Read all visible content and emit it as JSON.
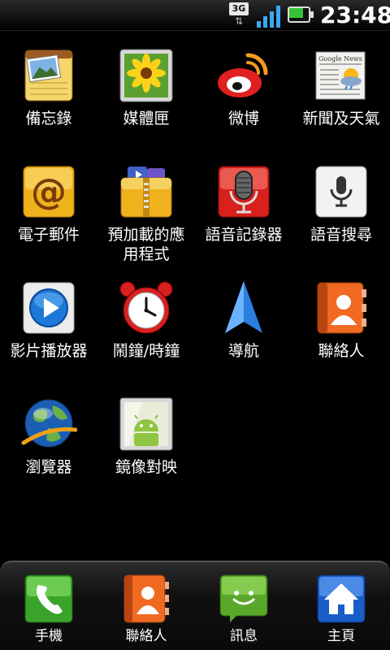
{
  "status_bar": {
    "network_type": "3G",
    "network_arrows": "⇅",
    "signal_icon": "signal-bars-icon",
    "battery_icon": "battery-icon",
    "battery_level": 0.7,
    "time": "23:48",
    "colors": {
      "signal": "#3aa8f0",
      "battery": "#35c335"
    }
  },
  "apps": [
    {
      "id": "notes",
      "label": "備忘錄",
      "icon": "notepad-icon"
    },
    {
      "id": "media",
      "label": "媒體匣",
      "icon": "gallery-icon"
    },
    {
      "id": "weibo",
      "label": "微博",
      "icon": "weibo-icon"
    },
    {
      "id": "news",
      "label": "新聞及天氣",
      "icon": "news-weather-icon",
      "icon_text": "Google News"
    },
    {
      "id": "email",
      "label": "電子郵件",
      "icon": "email-icon",
      "icon_text": "@"
    },
    {
      "id": "preloaded",
      "label_line1": "預加載的應",
      "label_line2": "用程式",
      "icon": "folder-icon"
    },
    {
      "id": "recorder",
      "label": "語音記錄器",
      "icon": "microphone-icon"
    },
    {
      "id": "voicesearch",
      "label": "語音搜尋",
      "icon": "voice-search-icon"
    },
    {
      "id": "video",
      "label": "影片播放器",
      "icon": "play-icon"
    },
    {
      "id": "clock",
      "label": "鬧鐘/時鐘",
      "icon": "alarm-clock-icon"
    },
    {
      "id": "navigation",
      "label": "導航",
      "icon": "navigation-arrow-icon"
    },
    {
      "id": "contacts",
      "label": "聯絡人",
      "icon": "contacts-icon"
    },
    {
      "id": "browser",
      "label": "瀏覽器",
      "icon": "globe-icon"
    },
    {
      "id": "mirror",
      "label": "鏡像對映",
      "icon": "android-mirror-icon"
    }
  ],
  "dock": [
    {
      "id": "phone",
      "label": "手機",
      "icon": "phone-icon"
    },
    {
      "id": "contacts",
      "label": "聯絡人",
      "icon": "contacts-icon"
    },
    {
      "id": "messages",
      "label": "訊息",
      "icon": "message-icon"
    },
    {
      "id": "home",
      "label": "主頁",
      "icon": "home-icon"
    }
  ]
}
